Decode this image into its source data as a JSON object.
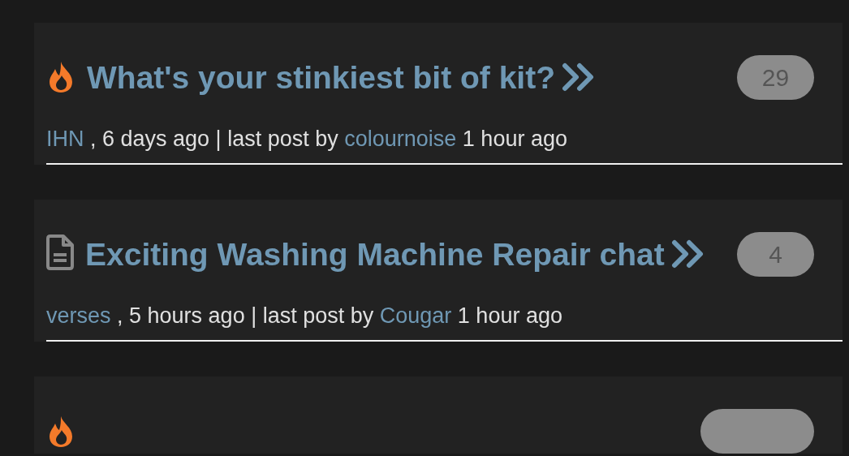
{
  "topics": [
    {
      "kind": "hot",
      "title": "What's your stinkiest bit of kit?",
      "count": "29",
      "author": "IHN",
      "posted": ", 6 days ago | last post by",
      "last_poster": "colournoise",
      "last_posted": "1 hour ago"
    },
    {
      "kind": "normal",
      "title": "Exciting Washing Machine Repair chat",
      "count": "4",
      "author": "verses",
      "posted": ", 5 hours ago | last post by",
      "last_poster": "Cougar",
      "last_posted": "1 hour ago"
    },
    {
      "kind": "hot"
    }
  ]
}
